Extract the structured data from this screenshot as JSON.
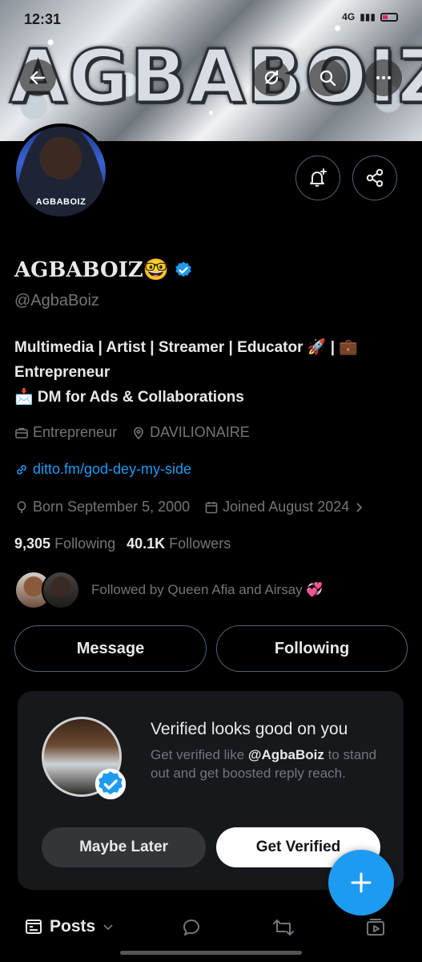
{
  "status_bar": {
    "time": "12:31",
    "network": "4G"
  },
  "banner": {
    "word": "AGBABOIZ"
  },
  "header": {
    "back_icon": "back-arrow-icon",
    "refresh_icon": "refresh-icon",
    "search_icon": "search-icon",
    "more_icon": "more-icon"
  },
  "avatar": {
    "shirt_text": "AGBABOIZ"
  },
  "profile": {
    "name": "AGBABOIZ🤓",
    "handle": "@AgbaBoiz",
    "bio_line1": "Multimedia | Artist | Streamer | Educator 🚀 | 💼",
    "bio_line2": "Entrepreneur",
    "bio_line3": "📩 DM for Ads & Collaborations",
    "category": "Entrepreneur",
    "location": "DAVILIONAIRE",
    "website": "ditto.fm/god-dey-my-side",
    "born": "Born September 5, 2000",
    "joined": "Joined August 2024",
    "following_count": "9,305",
    "following_label": "Following",
    "followers_count": "40.1K",
    "followers_label": "Followers",
    "followed_by": "Followed by Queen Afia and Airsay 💞"
  },
  "buttons": {
    "message": "Message",
    "following": "Following"
  },
  "verify_card": {
    "title": "Verified looks good on you",
    "sub_prefix": "Get verified like ",
    "sub_handle": "@AgbaBoiz",
    "sub_suffix": " to stand out and get boosted reply reach.",
    "maybe_later": "Maybe Later",
    "get_verified": "Get Verified"
  },
  "tabs": {
    "posts": "Posts"
  },
  "colors": {
    "accent": "#1d9bf0",
    "background": "#000000",
    "card": "#16181c",
    "muted": "#71767b"
  }
}
